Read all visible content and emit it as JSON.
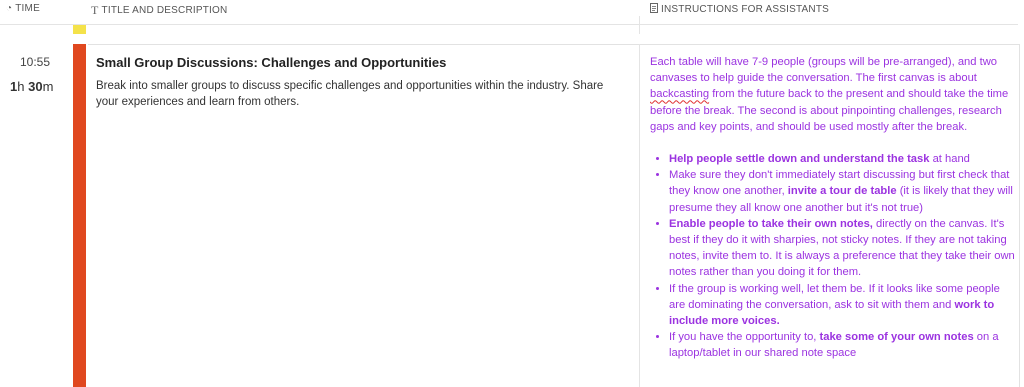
{
  "header": {
    "time_label": "TIME",
    "title_label": "TITLE AND DESCRIPTION",
    "instructions_label": "INSTRUCTIONS FOR ASSISTANTS"
  },
  "colors": {
    "session_bar": "#e0481f",
    "prev_bar": "#f4e24a",
    "instructions_text": "#9b33e0"
  },
  "item": {
    "start_time": "10:55",
    "duration_hours": "1",
    "duration_h_unit": "h",
    "duration_minutes": "30",
    "duration_m_unit": "m",
    "title": "Small Group Discussions: Challenges and Opportunities",
    "description": "Break into smaller groups to discuss specific challenges and opportunities within the industry. Share your experiences and learn from others.",
    "instructions": {
      "intro_a": "Each table will have 7-9 people (groups will be pre-arranged), and two canvases to help guide the conversation. The first canvas is about ",
      "intro_squiggle": "backcasting",
      "intro_b": " from the future back to the present and should take the time before the break. The second is about pinpointing challenges, research gaps and key points, and should be used mostly after the break.",
      "bullets": [
        {
          "b1": "Help people settle down and understand the task",
          "t1": " at hand"
        },
        {
          "t1": "Make sure they don't immediately start discussing but first check that they know one another, ",
          "b1": "invite a tour de table",
          "t2": " (it is likely that they will presume they all know one another but it's not true)"
        },
        {
          "b1": "Enable people to take their own notes,",
          "t1": " directly on the canvas. It's best if they do it with sharpies, not sticky notes. If they are not taking notes, invite them to. It is always a preference that they take their own notes rather than you doing it for them."
        },
        {
          "t1": "If the group is working well, let them be. If it looks like some people are dominating the conversation, ask to sit with them and ",
          "b1": "work to include more voices."
        },
        {
          "t1": "If you have the opportunity to, ",
          "b1": "take some of your own notes",
          "t2": " on a laptop/tablet in our shared note space"
        }
      ]
    }
  }
}
